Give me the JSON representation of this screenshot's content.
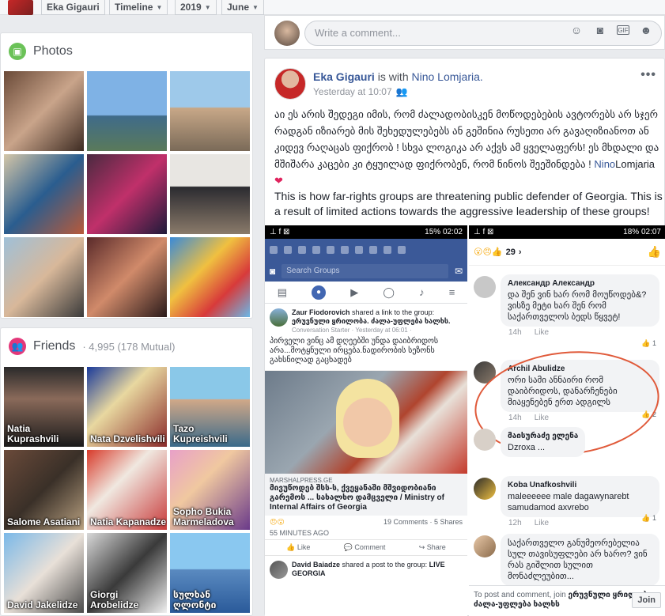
{
  "topbar": {
    "name": "Eka Gigauri",
    "timeline": "Timeline",
    "year": "2019",
    "month": "June"
  },
  "photos": {
    "title": "Photos"
  },
  "friends": {
    "title": "Friends",
    "count": "· 4,995 (178 Mutual)",
    "items": [
      {
        "name": "Natia Kuprashvili"
      },
      {
        "name": "Nata Dzvelishvili"
      },
      {
        "name": "Tazo Kupreishvili"
      },
      {
        "name": "Salome Asatiani"
      },
      {
        "name": "Natia Kapanadze"
      },
      {
        "name": "Sopho Bukia Marmeladova"
      },
      {
        "name": "David Jakelidze"
      },
      {
        "name": "Giorgi Arobelidze"
      },
      {
        "name": "სულხან ღლონტი"
      }
    ]
  },
  "comment_bar": {
    "placeholder": "Write a comment..."
  },
  "post": {
    "author": "Eka Gigauri",
    "with_word": "is with",
    "with_name": "Nino Lomjaria.",
    "time": "Yesterday at 10:07",
    "text_ka": "აი ეს არის შედეგი იმის, რომ ძალადობისკენ მოწოდებების ავტორებს არ სჯერ რადგან იზიარებ მის შეხედულებებს ან გეშინია რუსეთი არ გავაღიზიანოთ ან კიდევ რაღაცას ფიქრობ ! სხვა ლოგიკა არ აქვს ამ ყველაფერს! ეს მხდალი და მშიშარა კაცები კი ტყუილად ფიქრობენ, რომ ნინოს შეეშინდება !",
    "tag_first": "Nino",
    "tag_last": "Lomjaria",
    "heart": "❤",
    "text_en": "This is how far-rights groups are threatening public defender of Georgia. This is a result of limited actions towards the aggressive leadership of these groups!"
  },
  "shot1": {
    "status_right": "15% 02:02",
    "search": "Search Groups",
    "sharer": "Zaur Fiodorovich",
    "shared_text": "shared a link to the group:",
    "group": "ერუვნული ყრილობა. ძალა-უფლება ხალხს.",
    "meta": "Conversation Starter · Yesterday at 06:01 ·",
    "body": "პირველი ვინც ამ დღეებში უნდა დაიბრიდოს არა...მოტყნული ირცება.ნადირობის სეზონს გახსნილად გაცხადებ",
    "link_src": "MARSHALPRESS.GE",
    "link_title": "მივუწოდებ შსს-ს, ქვეყანაში მშვიდობიანი გარემოს ... სახალხო დამცველი / Ministry of Internal Affairs of Georgia",
    "comments": "19 Comments · 5 Shares",
    "ago": "55 MINUTES AGO",
    "like": "Like",
    "comment": "Comment",
    "share": "Share",
    "sharer2": "David Baiadze",
    "shared_text2": "shared a post to the group:",
    "group2": "LIVE GEORGIA"
  },
  "shot2": {
    "status_right": "18% 02:07",
    "reactions": "29",
    "comments": [
      {
        "name": "Александр Александр",
        "text": "და შენ ვინ ხარ რომ მოუწოდებ&?ვისზე მეტი ხარ შენ რომ საქართველოს ბედს წყვეტ!",
        "time": "14h",
        "like": "Like",
        "count": "1"
      },
      {
        "name": "Archil Abulidze",
        "text": "ორი სამი ანნაირი რომ დაიბრიდოს, დანარჩენები მიაყენებენ ერთ ადგილს",
        "time": "14h",
        "like": "Like",
        "count": "2"
      },
      {
        "name": "მაისურაძე ელენა",
        "text": "Dzroxa ...",
        "time": "",
        "like": "",
        "count": ""
      },
      {
        "name": "Koba Unafkoshvili",
        "text": "maleeeeee male dagawynarebt samudamod axvrebo",
        "time": "12h",
        "like": "Like",
        "count": "1"
      },
      {
        "name": "",
        "text": "საქართველო განუმეორებელია სულ თავისუფლები არ ხარო? ვინ რას გიშლით სულით მონაძლეუბით...",
        "time": "",
        "like": "",
        "count": ""
      }
    ],
    "join_text": "To post and comment, join",
    "join_group": "ერუვნული ყრილობა. ძალა-უფლება ხალხს",
    "join_btn": "Join"
  }
}
